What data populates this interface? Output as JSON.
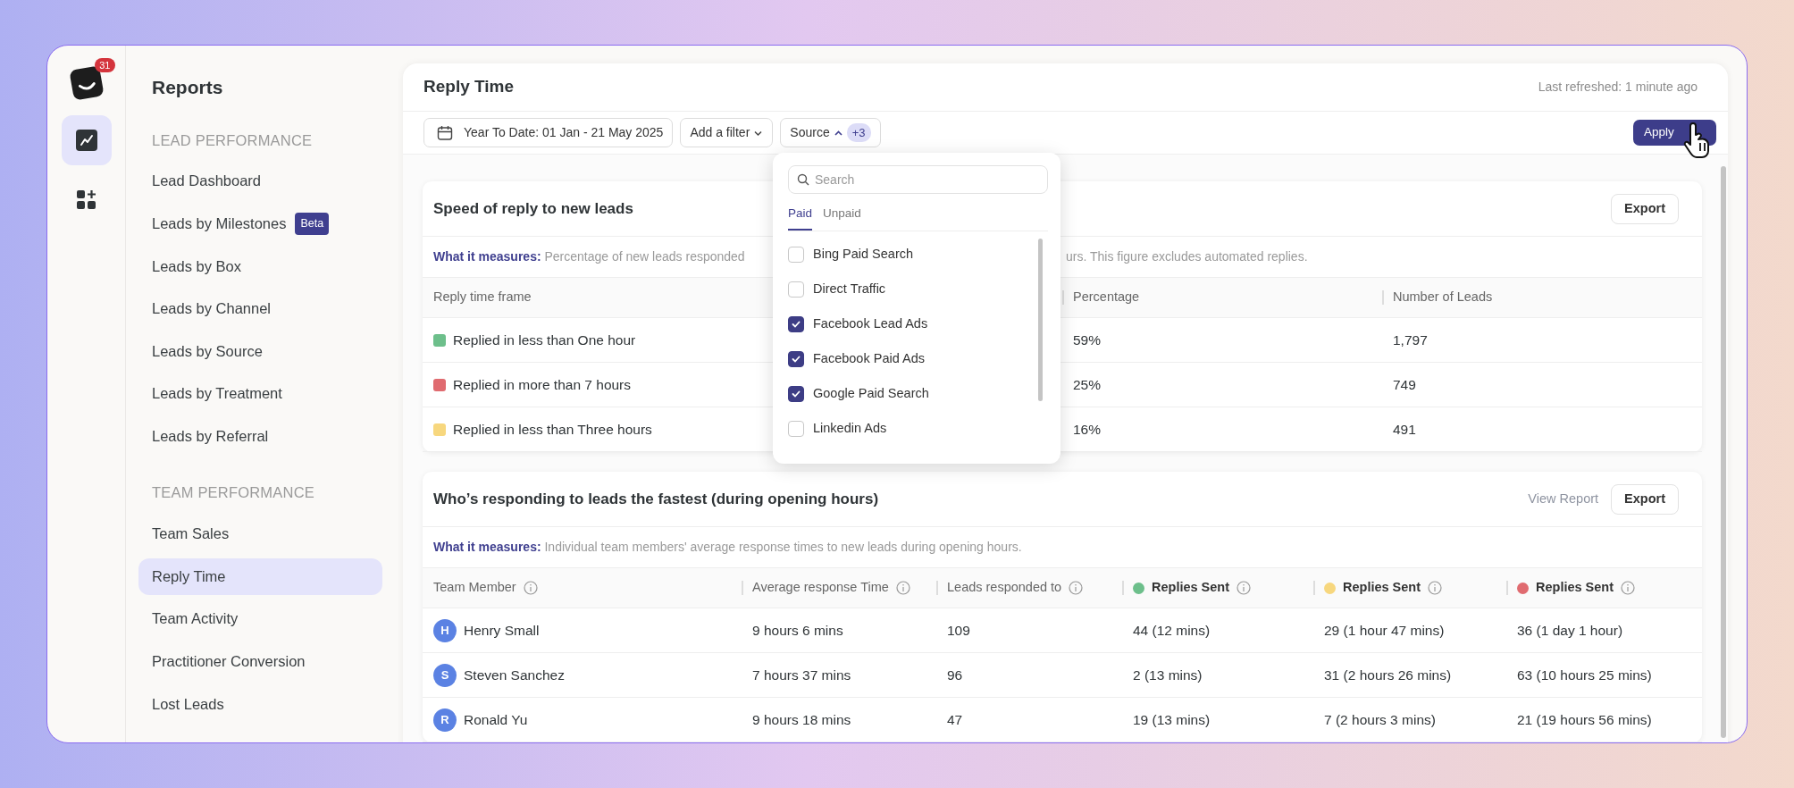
{
  "app": {
    "notification_count": "31"
  },
  "rail": [
    {
      "kind": "chart",
      "selected": true
    },
    {
      "kind": "add-widget",
      "selected": false
    }
  ],
  "sidebar": {
    "title": "Reports",
    "sections": [
      {
        "heading": "LEAD PERFORMANCE",
        "items": [
          {
            "label": "Lead Dashboard",
            "selected": false
          },
          {
            "label": "Leads by Milestones",
            "selected": false,
            "badge": "Beta"
          },
          {
            "label": "Leads by Box",
            "selected": false
          },
          {
            "label": "Leads by Channel",
            "selected": false
          },
          {
            "label": "Leads by Source",
            "selected": false
          },
          {
            "label": "Leads by Treatment",
            "selected": false
          },
          {
            "label": "Leads by Referral",
            "selected": false
          }
        ]
      },
      {
        "heading": "TEAM PERFORMANCE",
        "items": [
          {
            "label": "Team Sales",
            "selected": false
          },
          {
            "label": "Reply Time",
            "selected": true
          },
          {
            "label": "Team Activity",
            "selected": false
          },
          {
            "label": "Practitioner Conversion",
            "selected": false
          },
          {
            "label": "Lost Leads",
            "selected": false
          }
        ]
      }
    ]
  },
  "page": {
    "title": "Reply Time",
    "last_refreshed": "Last refreshed: 1 minute ago"
  },
  "filters": {
    "date": "Year To Date: 01 Jan - 21 May 2025",
    "add_filter": "Add a filter",
    "source": {
      "label": "Source",
      "expanded": true,
      "count": "+3"
    },
    "apply": "Apply"
  },
  "source_dropdown": {
    "placeholder": "Search",
    "tabs": [
      {
        "label": "Paid",
        "selected": true
      },
      {
        "label": "Unpaid",
        "selected": false
      }
    ],
    "options": [
      {
        "label": "Bing Paid Search",
        "checked": false
      },
      {
        "label": "Direct Traffic",
        "checked": false
      },
      {
        "label": "Facebook Lead Ads",
        "checked": true
      },
      {
        "label": "Facebook Paid Ads",
        "checked": true
      },
      {
        "label": "Google Paid Search",
        "checked": true
      },
      {
        "label": "Linkedin Ads",
        "checked": false
      }
    ]
  },
  "reports": [
    {
      "kind": "timeframe",
      "title": "Speed of reply to new leads",
      "actions": [
        {
          "kind": "button",
          "label": "Export"
        }
      ],
      "measure_label": "What it measures:",
      "measure_text": "Percentage of new leads responded",
      "measure_text_after": "urs. This figure excludes automated replies.",
      "columns": [
        {
          "label": "Reply time frame"
        },
        {
          "label": "Percentage"
        },
        {
          "label": "Number of Leads"
        }
      ],
      "rows": [
        {
          "color": "#6dbf8b",
          "cells": [
            "Replied in less than One hour",
            "59%",
            "1,797"
          ]
        },
        {
          "color": "#e06b70",
          "cells": [
            "Replied in more than 7 hours",
            "25%",
            "749"
          ]
        },
        {
          "color": "#f7d77e",
          "cells": [
            "Replied in less than Three hours",
            "16%",
            "491"
          ]
        }
      ]
    },
    {
      "kind": "members",
      "title": "Who’s responding to leads the fastest (during opening hours)",
      "actions": [
        {
          "kind": "link",
          "label": "View Report"
        },
        {
          "kind": "button",
          "label": "Export"
        }
      ],
      "measure_label": "What it measures:",
      "measure_text": "Individual team members' average response times to new leads during opening hours.",
      "columns": [
        {
          "label": "Team Member",
          "info": true
        },
        {
          "label": "Average response Time",
          "info": true
        },
        {
          "label": "Leads responded to",
          "info": true
        },
        {
          "label": "Replies Sent",
          "info": true,
          "color": "#6dbf8b"
        },
        {
          "label": "Replies Sent",
          "info": true,
          "color": "#f7d77e"
        },
        {
          "label": "Replies Sent",
          "info": true,
          "color": "#e06b70"
        }
      ],
      "rows": [
        {
          "initial": "H",
          "cells": [
            "Henry Small",
            "9 hours 6 mins",
            "109",
            "44 (12 mins)",
            "29 (1 hour 47 mins)",
            "36 (1 day 1 hour)"
          ]
        },
        {
          "initial": "S",
          "cells": [
            "Steven Sanchez",
            "7 hours 37 mins",
            "96",
            "2 (13 mins)",
            "31 (2 hours 26 mins)",
            "63 (10 hours 25 mins)"
          ]
        },
        {
          "initial": "R",
          "cells": [
            "Ronald Yu",
            "9 hours 18 mins",
            "47",
            "19 (13 mins)",
            "7 (2 hours 3 mins)",
            "21 (19 hours 56 mins)"
          ]
        }
      ]
    }
  ]
}
